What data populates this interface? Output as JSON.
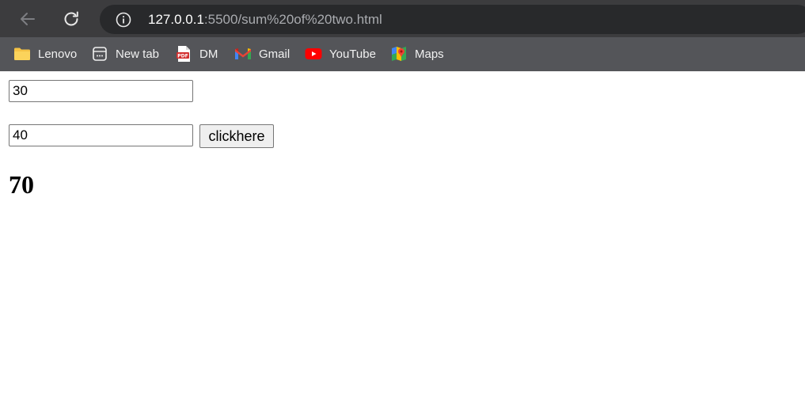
{
  "browser": {
    "url_host": "127.0.0.1",
    "url_path": ":5500/sum%20of%20two.html",
    "back_icon": "arrow-left-icon",
    "reload_icon": "reload-icon",
    "info_icon": "info-icon"
  },
  "bookmarks": [
    {
      "label": "Lenovo",
      "icon": "folder-icon"
    },
    {
      "label": "New tab",
      "icon": "new-tab-icon"
    },
    {
      "label": "DM",
      "icon": "pdf-icon"
    },
    {
      "label": "Gmail",
      "icon": "gmail-icon"
    },
    {
      "label": "YouTube",
      "icon": "youtube-icon"
    },
    {
      "label": "Maps",
      "icon": "maps-icon"
    }
  ],
  "page": {
    "first_number": "30",
    "second_number": "40",
    "button_label": "clickhere",
    "result": "70"
  },
  "colors": {
    "toolbar": "#3c3c3e",
    "omnibox": "#28292b",
    "bookmarks_bar": "#545559"
  }
}
